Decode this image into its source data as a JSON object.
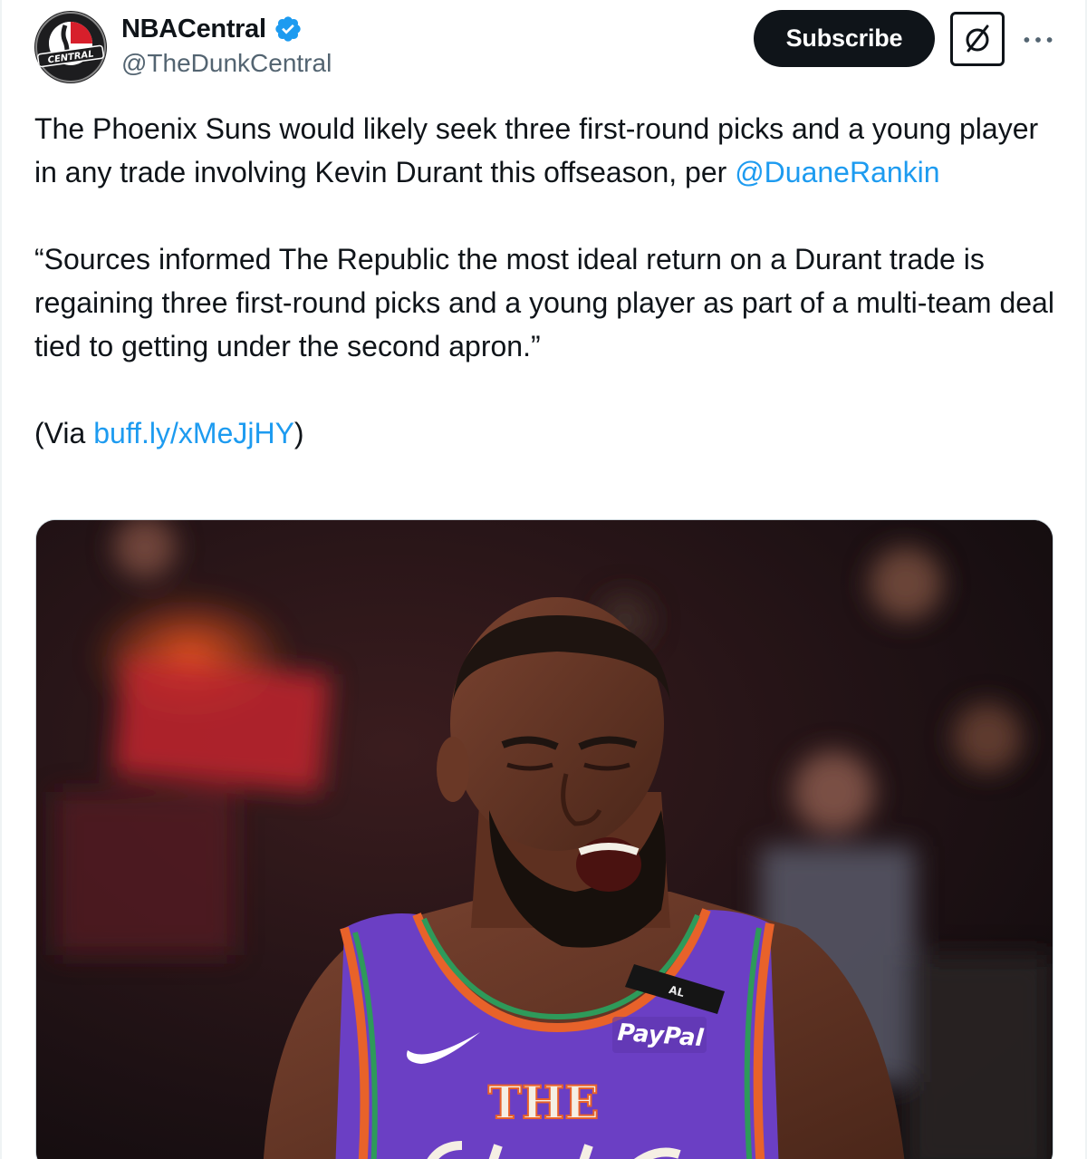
{
  "author": {
    "display_name": "NBACentral",
    "handle": "@TheDunkCentral",
    "avatar_text": "CENTRAL",
    "verified": true
  },
  "actions": {
    "subscribe_label": "Subscribe",
    "grok_icon": "grok-icon",
    "more_icon": "more-icon"
  },
  "tweet": {
    "para1_text": "The Phoenix Suns would likely seek three first-round picks and a young player in any trade involving Kevin Durant this offseason, per ",
    "para1_mention": "@DuaneRankin",
    "quote": "“Sources informed The Republic the most ideal return on a Durant trade is regaining three first-round picks and a young player as part of a multi-team deal tied to getting under the second apron.”",
    "via_prefix": "(Via ",
    "via_link": "buff.ly/xMeJjHY",
    "via_suffix": ")"
  },
  "media": {
    "jersey_sponsor": "PayPal",
    "jersey_text": "THE",
    "jersey_patch": "AL"
  },
  "colors": {
    "link": "#1d9bf0",
    "verified": "#1d9bf0",
    "jersey": "#6b3fc4",
    "trim_orange": "#e8622a",
    "trim_green": "#2e9a5a"
  }
}
